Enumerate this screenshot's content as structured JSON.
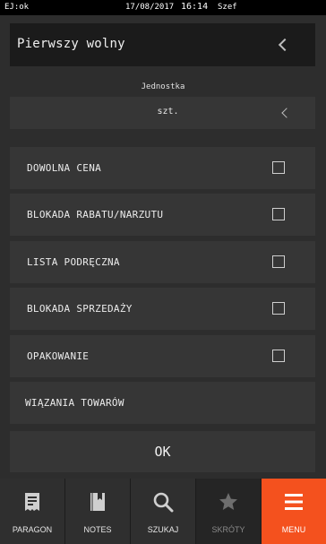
{
  "statusbar": {
    "left": "EJ:ok",
    "date": "17/08/2017",
    "time": "16:14",
    "user": "Szef"
  },
  "header": {
    "title": "Pierwszy wolny"
  },
  "unit": {
    "label": "Jednostka",
    "value": "szt."
  },
  "options": [
    {
      "label": "DOWOLNA CENA",
      "checked": false
    },
    {
      "label": "BLOKADA RABATU/NARZUTU",
      "checked": false
    },
    {
      "label": "LISTA PODRĘCZNA",
      "checked": false
    },
    {
      "label": "BLOKADA SPRZEDAŻY",
      "checked": false
    },
    {
      "label": "OPAKOWANIE",
      "checked": false
    }
  ],
  "bindings_row": {
    "label": "WIĄZANIA TOWARÓW"
  },
  "ok_label": "OK",
  "nav": [
    {
      "label": "PARAGON",
      "icon": "receipt-icon",
      "state": "normal"
    },
    {
      "label": "NOTES",
      "icon": "notebook-icon",
      "state": "normal"
    },
    {
      "label": "SZUKAJ",
      "icon": "search-icon",
      "state": "normal"
    },
    {
      "label": "SKRÓTY",
      "icon": "star-icon",
      "state": "disabled"
    },
    {
      "label": "MENU",
      "icon": "menu-icon",
      "state": "active"
    }
  ],
  "colors": {
    "accent": "#f4511e",
    "background": "#2d2d2d",
    "row": "#363636",
    "header": "#1b1b1b"
  }
}
